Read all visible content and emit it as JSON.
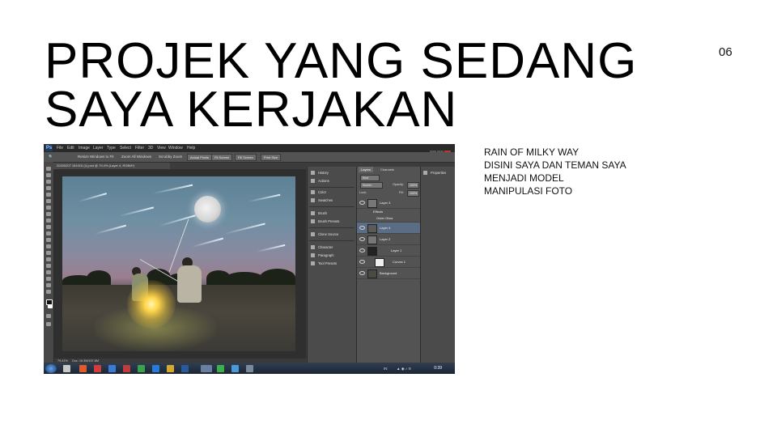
{
  "slide": {
    "title_lines": [
      "PROJEK YANG SEDANG",
      "SAYA KERJAKAN"
    ],
    "page_number": "06",
    "description_lines": [
      "RAIN OF MILKY WAY",
      "DISINI SAYA DAN TEMAN SAYA",
      "MENJADI MODEL",
      "MANIPULASI FOTO"
    ]
  },
  "photoshop": {
    "logo": "Ps",
    "menu": [
      "File",
      "Edit",
      "Image",
      "Layer",
      "Type",
      "Select",
      "Filter",
      "3D",
      "View",
      "Window",
      "Help"
    ],
    "options_bar": {
      "resize_windows": "Resize Windows to Fit",
      "zoom_all": "Zoom All Windows",
      "scrubby_zoom": "Scrubby Zoom",
      "actual_pixels": "Actual Pixels",
      "fit_screen": "Fit Screen",
      "fill_screen": "Fill Screen",
      "print_size": "Print Size"
    },
    "document_tab": "20200207 181015 (1).psd @ 79.4% (Layer 4, RGB/8*)",
    "collapsed_panels": [
      "History",
      "Actions",
      "Color",
      "Swatches",
      "Brush",
      "Brush Presets",
      "Clone Source",
      "Character",
      "Paragraph",
      "Tool Presets"
    ],
    "layers_panel": {
      "tabs": [
        "Layers",
        "Channels"
      ],
      "kind": "Kind",
      "blend_mode": "Screen",
      "opacity_label": "Opacity:",
      "opacity_value": "100%",
      "lock_label": "Lock:",
      "fill_label": "Fill:",
      "fill_value": "100%",
      "layers": [
        "Layer 3",
        "Effects",
        "Outer Glow",
        "Layer 4",
        "Layer 2",
        "Layer 1",
        "Curves 1",
        "Background"
      ]
    },
    "properties_label": "Properties",
    "status": {
      "zoom": "79.41%",
      "doc": "Doc: 16.3M/157.8M"
    },
    "taskbar": {
      "lang": "IN",
      "clock": "0:39"
    }
  }
}
